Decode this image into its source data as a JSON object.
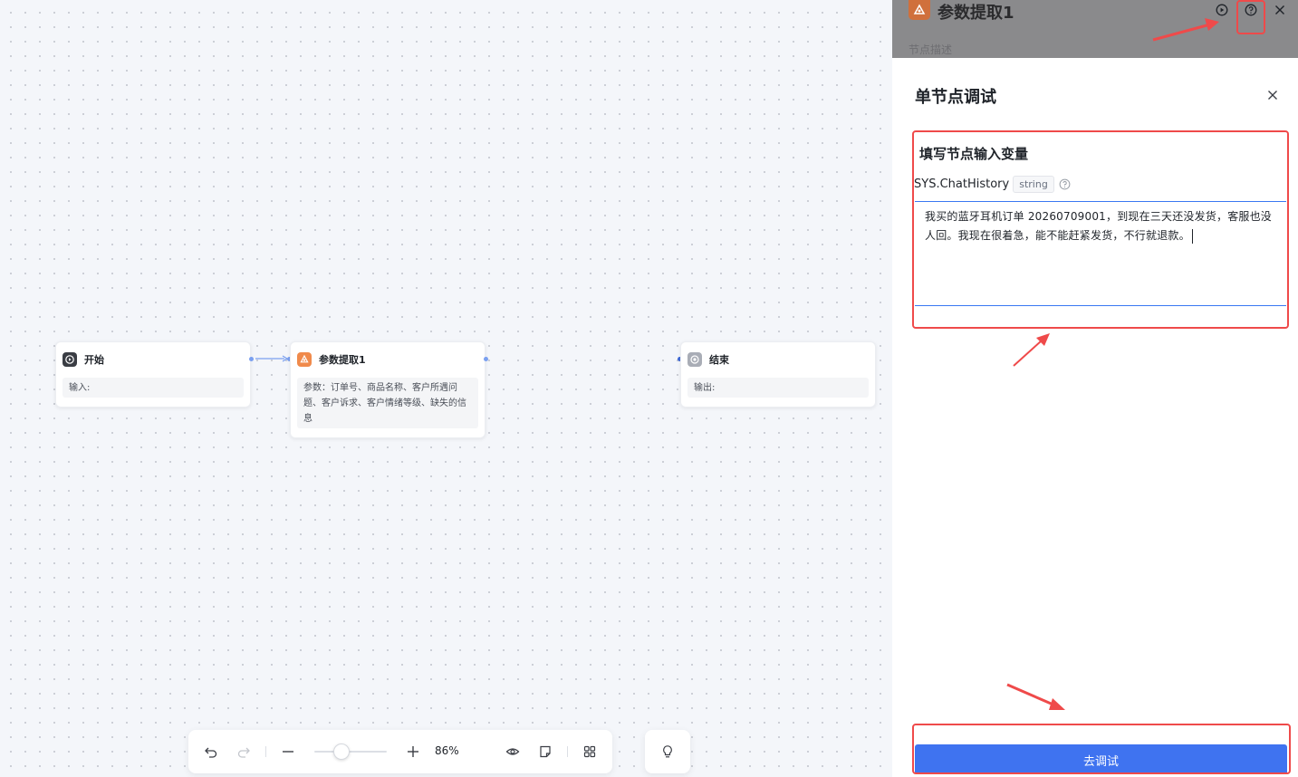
{
  "canvas": {
    "nodes": {
      "start": {
        "title": "开始",
        "body": "输入:"
      },
      "extract": {
        "title": "参数提取1",
        "body": "参数：订单号、商品名称、客户所遇问题、客户诉求、客户情绪等级、缺失的信息"
      },
      "end": {
        "title": "结束",
        "body": "输出:"
      }
    }
  },
  "toolbar": {
    "zoom_value": "86%",
    "zoom_percent": 86,
    "icons": [
      "undo-icon",
      "redo-icon",
      "zoom-out-icon",
      "zoom-in-icon",
      "eye-icon",
      "note-icon",
      "grid-icon",
      "lightbulb-icon"
    ]
  },
  "panel_header": {
    "title": "参数提取1",
    "description_placeholder": "节点描述"
  },
  "drawer": {
    "title": "单节点调试",
    "section_title": "填写节点输入变量",
    "variable": {
      "name": "SYS.ChatHistory",
      "type": "string"
    },
    "input_value": "我买的蓝牙耳机订单 20260709001，到现在三天还没发货，客服也没人回。我现在很着急，能不能赶紧发货，不行就退款。",
    "submit_label": "去调试"
  },
  "colors": {
    "accent": "#3f73f0",
    "annotation": "#ef4a4a",
    "extract_icon": "#f08a4b"
  }
}
